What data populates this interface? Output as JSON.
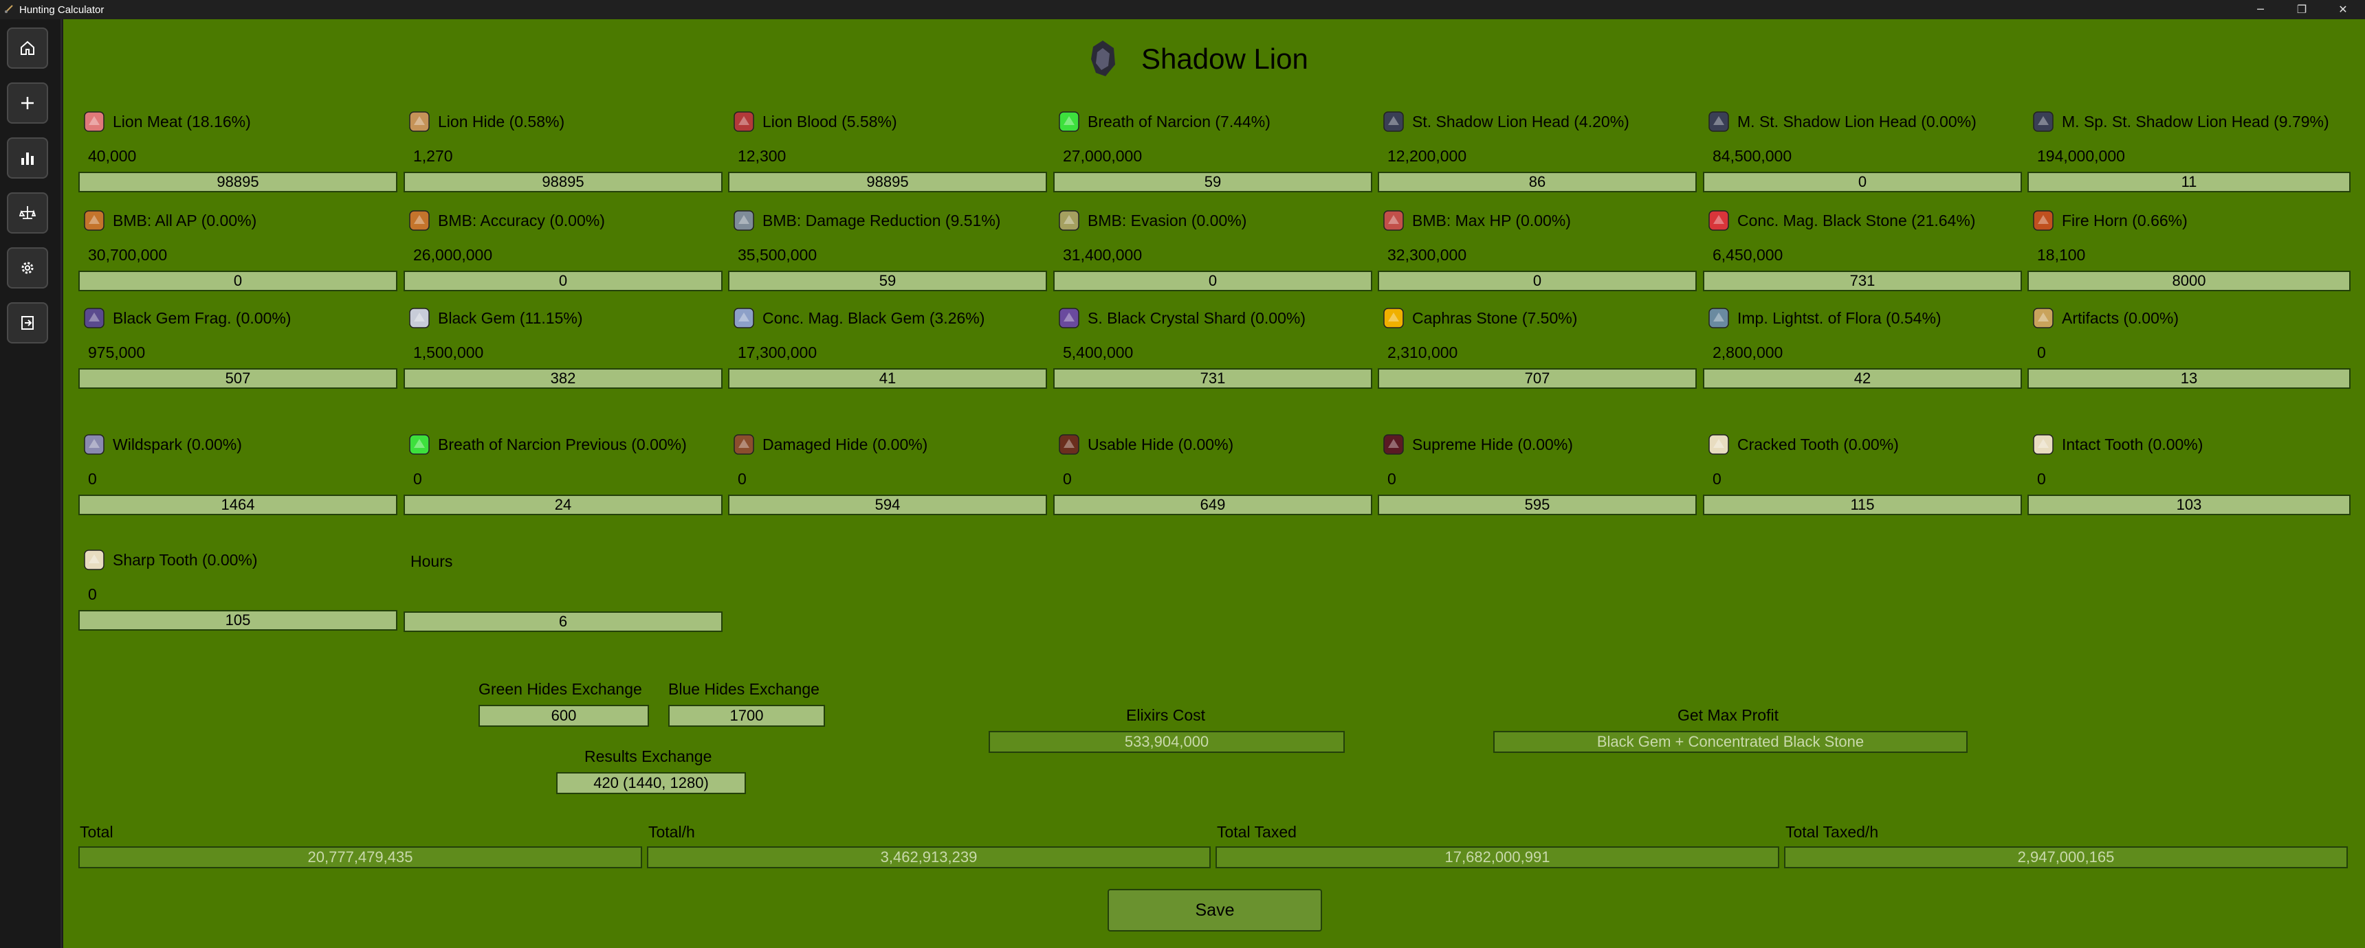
{
  "window": {
    "title": "Hunting Calculator",
    "controls": {
      "minimize": "─",
      "restore": "❐",
      "close": "✕"
    }
  },
  "sidebar": {
    "items": [
      {
        "name": "home",
        "icon": "home-icon"
      },
      {
        "name": "add",
        "icon": "plus-icon"
      },
      {
        "name": "statistics",
        "icon": "bar-chart-icon"
      },
      {
        "name": "scale",
        "icon": "scale-icon"
      },
      {
        "name": "settings",
        "icon": "gear-icon"
      },
      {
        "name": "exit",
        "icon": "exit-icon"
      }
    ]
  },
  "header": {
    "title": "Shadow Lion",
    "icon": "shadow-lion-icon"
  },
  "items": [
    {
      "name": "Lion Meat (18.16%)",
      "price": "40,000",
      "qty": "98895",
      "icon": "meat-icon",
      "color": "#e07a7a"
    },
    {
      "name": "Lion Hide (0.58%)",
      "price": "1,270",
      "qty": "98895",
      "icon": "hide-icon",
      "color": "#c59358"
    },
    {
      "name": "Lion Blood (5.58%)",
      "price": "12,300",
      "qty": "98895",
      "icon": "blood-vial-icon",
      "color": "#b33a3a"
    },
    {
      "name": "Breath of Narcion (7.44%)",
      "price": "27,000,000",
      "qty": "59",
      "icon": "breath-icon",
      "color": "#3de03d"
    },
    {
      "name": "St. Shadow Lion Head (4.20%)",
      "price": "12,200,000",
      "qty": "86",
      "icon": "lion-head-icon",
      "color": "#3a3f55"
    },
    {
      "name": "M. St. Shadow Lion Head (0.00%)",
      "price": "84,500,000",
      "qty": "0",
      "icon": "lion-head-icon",
      "color": "#3a3f55"
    },
    {
      "name": "M. Sp. St. Shadow Lion Head (9.79%)",
      "price": "194,000,000",
      "qty": "11",
      "icon": "lion-head-icon",
      "color": "#3a3f55"
    },
    {
      "name": "BMB: All AP (0.00%)",
      "price": "30,700,000",
      "qty": "0",
      "icon": "box-icon",
      "color": "#c4742c"
    },
    {
      "name": "BMB: Accuracy (0.00%)",
      "price": "26,000,000",
      "qty": "0",
      "icon": "box-icon",
      "color": "#c4742c"
    },
    {
      "name": "BMB: Damage Reduction (9.51%)",
      "price": "35,500,000",
      "qty": "59",
      "icon": "box-icon",
      "color": "#7f8c99"
    },
    {
      "name": "BMB: Evasion (0.00%)",
      "price": "31,400,000",
      "qty": "0",
      "icon": "box-icon",
      "color": "#a5a060"
    },
    {
      "name": "BMB: Max HP (0.00%)",
      "price": "32,300,000",
      "qty": "0",
      "icon": "box-icon",
      "color": "#c2504a"
    },
    {
      "name": "Conc. Mag. Black Stone (21.64%)",
      "price": "6,450,000",
      "qty": "731",
      "icon": "stone-icon",
      "color": "#d8353a"
    },
    {
      "name": "Fire Horn (0.66%)",
      "price": "18,100",
      "qty": "8000",
      "icon": "horn-icon",
      "color": "#c0501f"
    },
    {
      "name": "Black Gem Frag. (0.00%)",
      "price": "975,000",
      "qty": "507",
      "icon": "gem-fragment-icon",
      "color": "#5a4a8e"
    },
    {
      "name": "Black Gem (11.15%)",
      "price": "1,500,000",
      "qty": "382",
      "icon": "gem-icon",
      "color": "#c8ccd8"
    },
    {
      "name": "Conc. Mag. Black Gem (3.26%)",
      "price": "17,300,000",
      "qty": "41",
      "icon": "gem-icon",
      "color": "#8da0c8"
    },
    {
      "name": "S. Black Crystal Shard (0.00%)",
      "price": "5,400,000",
      "qty": "731",
      "icon": "crystal-shard-icon",
      "color": "#6a4a9e"
    },
    {
      "name": "Caphras Stone (7.50%)",
      "price": "2,310,000",
      "qty": "707",
      "icon": "caphras-stone-icon",
      "color": "#f0b000"
    },
    {
      "name": "Imp. Lightst. of Flora (0.54%)",
      "price": "2,800,000",
      "qty": "42",
      "icon": "lightstone-icon",
      "color": "#6a8aa0"
    },
    {
      "name": "Artifacts (0.00%)",
      "price": "0",
      "qty": "13",
      "icon": "artifact-icon",
      "color": "#c9a35c"
    },
    {
      "name": "Wildspark (0.00%)",
      "price": "0",
      "qty": "1464",
      "icon": "wildspark-icon",
      "color": "#8a8ab0"
    },
    {
      "name": "Breath of Narcion Previous (0.00%)",
      "price": "0",
      "qty": "24",
      "icon": "breath-icon",
      "color": "#3de03d"
    },
    {
      "name": "Damaged Hide (0.00%)",
      "price": "0",
      "qty": "594",
      "icon": "hide-icon",
      "color": "#8b4e2e"
    },
    {
      "name": "Usable Hide (0.00%)",
      "price": "0",
      "qty": "649",
      "icon": "hide-icon",
      "color": "#6b2e1e"
    },
    {
      "name": "Supreme Hide (0.00%)",
      "price": "0",
      "qty": "595",
      "icon": "hide-icon",
      "color": "#5a1a24"
    },
    {
      "name": "Cracked Tooth (0.00%)",
      "price": "0",
      "qty": "115",
      "icon": "tooth-icon",
      "color": "#e8dcc0"
    },
    {
      "name": "Intact Tooth (0.00%)",
      "price": "0",
      "qty": "103",
      "icon": "tooth-icon",
      "color": "#e8dcc0"
    },
    {
      "name": "Sharp Tooth (0.00%)",
      "price": "0",
      "qty": "105",
      "icon": "tooth-icon",
      "color": "#e8dcc0"
    }
  ],
  "hours": {
    "label": "Hours",
    "value": "6"
  },
  "exchange": {
    "green_label": "Green Hides Exchange",
    "green_value": "600",
    "blue_label": "Blue Hides Exchange",
    "blue_value": "1700",
    "results_label": "Results Exchange",
    "results_value": "420 (1440, 1280)"
  },
  "elixirs": {
    "label": "Elixirs Cost",
    "value": "533,904,000"
  },
  "max_profit": {
    "label": "Get Max Profit",
    "value": "Black Gem + Concentrated Black Stone"
  },
  "totals": {
    "total_label": "Total",
    "total_value": "20,777,479,435",
    "total_h_label": "Total/h",
    "total_h_value": "3,462,913,239",
    "taxed_label": "Total Taxed",
    "taxed_value": "17,682,000,991",
    "taxed_h_label": "Total Taxed/h",
    "taxed_h_value": "2,947,000,165"
  },
  "save_label": "Save"
}
